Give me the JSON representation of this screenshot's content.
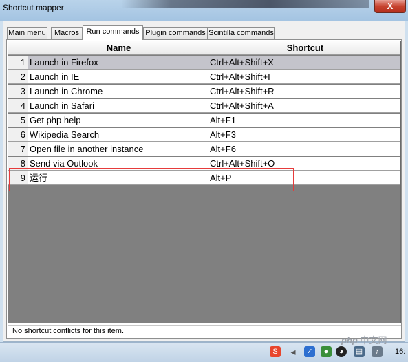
{
  "window": {
    "title": "Shortcut mapper",
    "close_label": "X"
  },
  "tabs": [
    {
      "label": "Main menu",
      "active": false
    },
    {
      "label": "Macros",
      "active": false
    },
    {
      "label": "Run commands",
      "active": true
    },
    {
      "label": "Plugin commands",
      "active": false
    },
    {
      "label": "Scintilla commands",
      "active": false
    }
  ],
  "grid": {
    "headers": {
      "num": "",
      "name": "Name",
      "shortcut": "Shortcut"
    },
    "rows": [
      {
        "num": "1",
        "name": "Launch in Firefox",
        "shortcut": "Ctrl+Alt+Shift+X"
      },
      {
        "num": "2",
        "name": "Launch in IE",
        "shortcut": "Ctrl+Alt+Shift+I"
      },
      {
        "num": "3",
        "name": "Launch in Chrome",
        "shortcut": "Ctrl+Alt+Shift+R"
      },
      {
        "num": "4",
        "name": "Launch in Safari",
        "shortcut": "Ctrl+Alt+Shift+A"
      },
      {
        "num": "5",
        "name": "Get php help",
        "shortcut": "Alt+F1"
      },
      {
        "num": "6",
        "name": "Wikipedia Search",
        "shortcut": "Alt+F3"
      },
      {
        "num": "7",
        "name": "Open file in another instance",
        "shortcut": "Alt+F6"
      },
      {
        "num": "8",
        "name": "Send via Outlook",
        "shortcut": "Ctrl+Alt+Shift+O"
      },
      {
        "num": "9",
        "name": "运行",
        "shortcut": "Alt+P"
      }
    ],
    "selected_row": 1,
    "highlighted_row": 9
  },
  "status": {
    "text": "No shortcut conflicts for this item."
  },
  "taskbar": {
    "clock": "16:",
    "icons": [
      "sogou-icon",
      "shield-icon",
      "security-icon",
      "qq-icon",
      "network-icon",
      "volume-icon"
    ]
  },
  "watermark": {
    "brand": "php",
    "suffix": "中文网"
  },
  "colors": {
    "selection": "#c4c4cb",
    "highlight_border": "#e63b3b",
    "grid_empty": "#808080",
    "titlebar": "#a4c4e2"
  }
}
